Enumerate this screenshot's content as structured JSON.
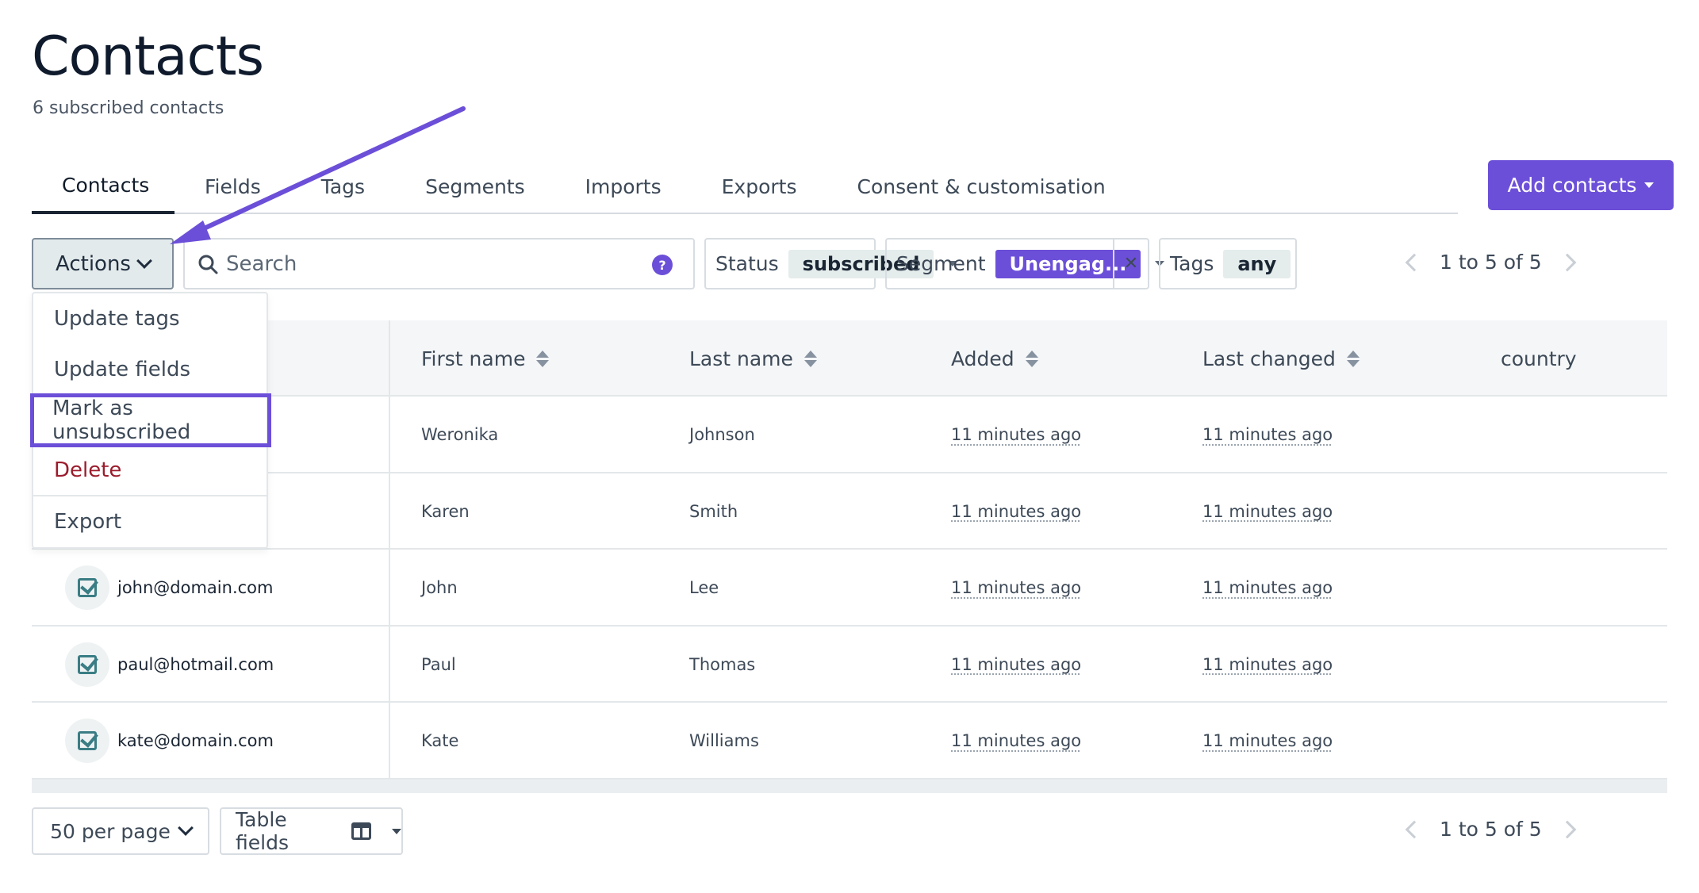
{
  "header": {
    "title": "Contacts",
    "subtitle": "6 subscribed contacts"
  },
  "tabs": [
    {
      "label": "Contacts",
      "active": true
    },
    {
      "label": "Fields"
    },
    {
      "label": "Tags"
    },
    {
      "label": "Segments"
    },
    {
      "label": "Imports"
    },
    {
      "label": "Exports"
    },
    {
      "label": "Consent & customisation"
    }
  ],
  "add_contacts_label": "Add contacts",
  "toolbar": {
    "actions_label": "Actions",
    "search_placeholder": "Search",
    "help_label": "?",
    "status": {
      "label": "Status",
      "value": "subscribed"
    },
    "segment": {
      "label": "Segment",
      "value": "Unengag...",
      "clear": "✕"
    },
    "tags": {
      "label": "Tags",
      "value": "any"
    },
    "pagination": "1 to 5 of 5"
  },
  "actions_menu": [
    {
      "label": "Update tags"
    },
    {
      "label": "Update fields"
    },
    {
      "label": "Mark as unsubscribed",
      "highlighted": true
    },
    {
      "label": "Delete",
      "danger": true
    },
    {
      "label": "Export"
    }
  ],
  "table": {
    "columns": [
      "First name",
      "Last name",
      "Added",
      "Last changed",
      "country"
    ],
    "rows": [
      {
        "email": "",
        "first": "Weronika",
        "last": "Johnson",
        "added": "11 minutes ago",
        "changed": "11 minutes ago",
        "checked": true
      },
      {
        "email": "",
        "first": "Karen",
        "last": "Smith",
        "added": "11 minutes ago",
        "changed": "11 minutes ago",
        "checked": true
      },
      {
        "email": "john@domain.com",
        "first": "John",
        "last": "Lee",
        "added": "11 minutes ago",
        "changed": "11 minutes ago",
        "checked": true
      },
      {
        "email": "paul@hotmail.com",
        "first": "Paul",
        "last": "Thomas",
        "added": "11 minutes ago",
        "changed": "11 minutes ago",
        "checked": true
      },
      {
        "email": "kate@domain.com",
        "first": "Kate",
        "last": "Williams",
        "added": "11 minutes ago",
        "changed": "11 minutes ago",
        "checked": true
      }
    ]
  },
  "footer": {
    "per_page": "50 per page",
    "table_fields": "Table fields",
    "pagination": "1 to 5 of 5"
  },
  "colors": {
    "accent": "#6c4fd8",
    "danger": "#9b1c2c",
    "check": "#3a7d84"
  }
}
